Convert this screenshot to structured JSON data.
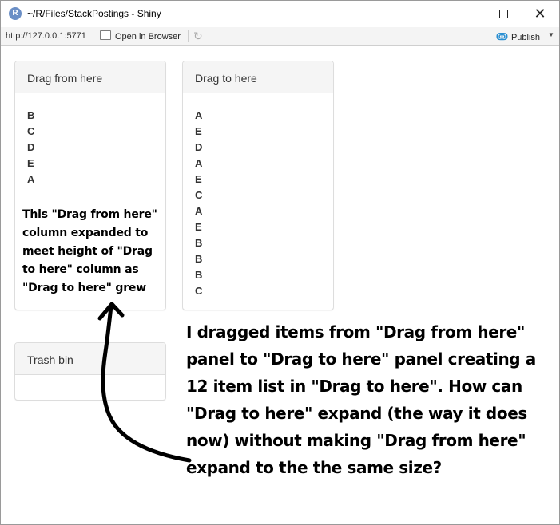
{
  "window": {
    "title": "~/R/Files/StackPostings - Shiny",
    "app_icon_letter": "R",
    "controls": {
      "minimize": "minimize",
      "maximize": "maximize",
      "close": "✕"
    }
  },
  "toolbar": {
    "url": "http://127.0.0.1:5771",
    "open_in_browser": "Open in Browser",
    "publish": "Publish",
    "publish_caret": "▼"
  },
  "panels": {
    "from": {
      "title": "Drag from here",
      "items": [
        "B",
        "C",
        "D",
        "E",
        "A"
      ]
    },
    "to": {
      "title": "Drag to here",
      "items": [
        "A",
        "E",
        "D",
        "A",
        "E",
        "C",
        "A",
        "E",
        "B",
        "B",
        "B",
        "C"
      ]
    },
    "trash": {
      "title": "Trash bin"
    }
  },
  "annotations": {
    "small": "This \"Drag from here\" column expanded to meet height of \"Drag to here\" column as \"Drag to here\" grew",
    "large": "I dragged items from \"Drag from here\" panel to \"Drag to here\" panel creating a 12 item list in \"Drag to here\". How can \"Drag to here\" expand (the way it does now) without making \"Drag from here\" expand to the the same size?"
  },
  "colors": {
    "panel_heading_bg": "#f5f5f5",
    "panel_border": "#dddddd",
    "publish_icon": "#2a8fd2"
  },
  "icons": {
    "app": "r-logo-icon",
    "open_in_browser": "browser-window-icon",
    "refresh": "refresh-icon",
    "publish": "publish-icon"
  }
}
